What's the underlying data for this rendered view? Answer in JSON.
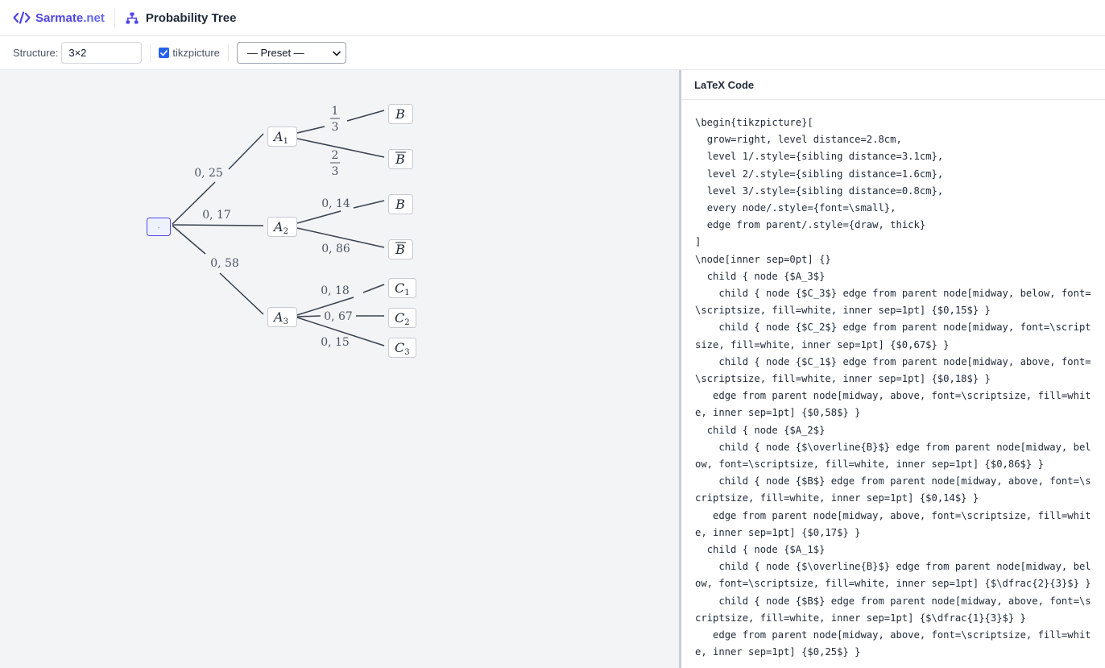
{
  "header": {
    "brand_name": "Sarmate",
    "brand_suffix": ".net",
    "app_title": "Probability Tree",
    "brand_color": "#4f46e5"
  },
  "toolbar": {
    "structure_label": "Structure:",
    "structure_value": "3×2",
    "tikz_label": "tikzpicture",
    "tikz_checked": true,
    "preset_value": "— Preset —"
  },
  "tree": {
    "root_label": "·",
    "level1": [
      {
        "node": "A",
        "sub": "1",
        "prob": "0, 25"
      },
      {
        "node": "A",
        "sub": "2",
        "prob": "0, 17"
      },
      {
        "node": "A",
        "sub": "3",
        "prob": "0, 58"
      }
    ],
    "level2": [
      {
        "node": "B",
        "overline": false,
        "prob_num": "1",
        "prob_den": "3"
      },
      {
        "node": "B",
        "overline": true,
        "prob_num": "2",
        "prob_den": "3"
      },
      {
        "node": "B",
        "overline": false,
        "prob": "0, 14"
      },
      {
        "node": "B",
        "overline": true,
        "prob": "0, 86"
      },
      {
        "node": "C",
        "sub": "1",
        "prob": "0, 18"
      },
      {
        "node": "C",
        "sub": "2",
        "prob": "0, 67"
      },
      {
        "node": "C",
        "sub": "3",
        "prob": "0, 15"
      }
    ]
  },
  "code_panel": {
    "title": "LaTeX Code",
    "code": "\\begin{tikzpicture}[\n  grow=right, level distance=2.8cm,\n  level 1/.style={sibling distance=3.1cm},\n  level 2/.style={sibling distance=1.6cm},\n  level 3/.style={sibling distance=0.8cm},\n  every node/.style={font=\\small},\n  edge from parent/.style={draw, thick}\n]\n\\node[inner sep=0pt] {}\n  child { node {$A_3$}\n    child { node {$C_3$} edge from parent node[midway, below, font=\\scriptsize, fill=white, inner sep=1pt] {$0,15$} }\n    child { node {$C_2$} edge from parent node[midway, font=\\scriptsize, fill=white, inner sep=1pt] {$0,67$} }\n    child { node {$C_1$} edge from parent node[midway, above, font=\\scriptsize, fill=white, inner sep=1pt] {$0,18$} }\n   edge from parent node[midway, above, font=\\scriptsize, fill=white, inner sep=1pt] {$0,58$} }\n  child { node {$A_2$}\n    child { node {$\\overline{B}$} edge from parent node[midway, below, font=\\scriptsize, fill=white, inner sep=1pt] {$0,86$} }\n    child { node {$B$} edge from parent node[midway, above, font=\\scriptsize, fill=white, inner sep=1pt] {$0,14$} }\n   edge from parent node[midway, above, font=\\scriptsize, fill=white, inner sep=1pt] {$0,17$} }\n  child { node {$A_1$}\n    child { node {$\\overline{B}$} edge from parent node[midway, below, font=\\scriptsize, fill=white, inner sep=1pt] {$\\dfrac{2}{3}$} }\n    child { node {$B$} edge from parent node[midway, above, font=\\scriptsize, fill=white, inner sep=1pt] {$\\dfrac{1}{3}$} }\n   edge from parent node[midway, above, font=\\scriptsize, fill=white, inner sep=1pt] {$0,25$} }"
  }
}
